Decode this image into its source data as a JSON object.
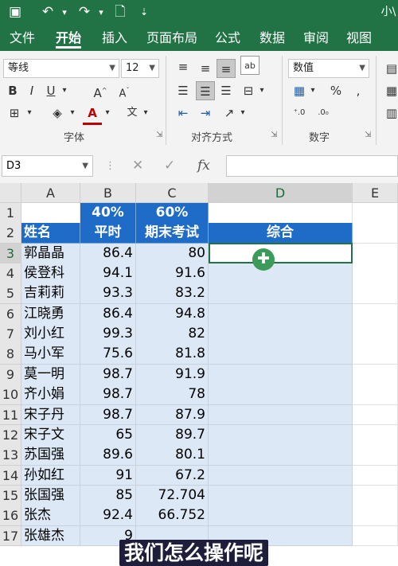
{
  "titlebar": {
    "save_icon": "save-icon",
    "undo_icon": "undo-icon",
    "redo_icon": "redo-icon",
    "new_icon": "new-file-icon",
    "customize_icon": "customize-qat-icon",
    "title_fragment": "小\\"
  },
  "ribbon_tabs": [
    "文件",
    "开始",
    "插入",
    "页面布局",
    "公式",
    "数据",
    "审阅",
    "视图"
  ],
  "ribbon": {
    "font_name": "等线",
    "font_size": "12",
    "number_format": "数值",
    "groups": {
      "font": "字体",
      "alignment": "对齐方式",
      "number": "数字"
    }
  },
  "formula_bar": {
    "name_box": "D3",
    "fx_label": "fx",
    "formula": ""
  },
  "columns": [
    "A",
    "B",
    "C",
    "D",
    "E"
  ],
  "rows": [
    {
      "num": "1",
      "a": "",
      "b": "40%",
      "c": "60%",
      "d": ""
    },
    {
      "num": "2",
      "a": "姓名",
      "b": "平时",
      "c": "期末考试",
      "d": "综合"
    },
    {
      "num": "3",
      "a": "郭晶晶",
      "b": "86.4",
      "c": "80",
      "d": ""
    },
    {
      "num": "4",
      "a": "侯登科",
      "b": "94.1",
      "c": "91.6",
      "d": ""
    },
    {
      "num": "5",
      "a": "吉莉莉",
      "b": "93.3",
      "c": "83.2",
      "d": ""
    },
    {
      "num": "6",
      "a": "江晓勇",
      "b": "86.4",
      "c": "94.8",
      "d": ""
    },
    {
      "num": "7",
      "a": "刘小红",
      "b": "99.3",
      "c": "82",
      "d": ""
    },
    {
      "num": "8",
      "a": "马小军",
      "b": "75.6",
      "c": "81.8",
      "d": ""
    },
    {
      "num": "9",
      "a": "莫一明",
      "b": "98.7",
      "c": "91.9",
      "d": ""
    },
    {
      "num": "10",
      "a": "齐小娟",
      "b": "98.7",
      "c": "78",
      "d": ""
    },
    {
      "num": "11",
      "a": "宋子丹",
      "b": "98.7",
      "c": "87.9",
      "d": ""
    },
    {
      "num": "12",
      "a": "宋子文",
      "b": "65",
      "c": "89.7",
      "d": ""
    },
    {
      "num": "13",
      "a": "苏国强",
      "b": "89.6",
      "c": "80.1",
      "d": ""
    },
    {
      "num": "14",
      "a": "孙如红",
      "b": "91",
      "c": "67.2",
      "d": ""
    },
    {
      "num": "15",
      "a": "张国强",
      "b": "85",
      "c": "72.704",
      "d": ""
    },
    {
      "num": "16",
      "a": "张杰",
      "b": "92.4",
      "c": "66.752",
      "d": ""
    },
    {
      "num": "17",
      "a": "张雄杰",
      "b": "9",
      "c": "",
      "d": ""
    }
  ],
  "subtitle": "我们怎么操作呢",
  "colors": {
    "brand": "#217346",
    "header_blue": "#1f6cc8",
    "selection": "#dce8f5"
  }
}
